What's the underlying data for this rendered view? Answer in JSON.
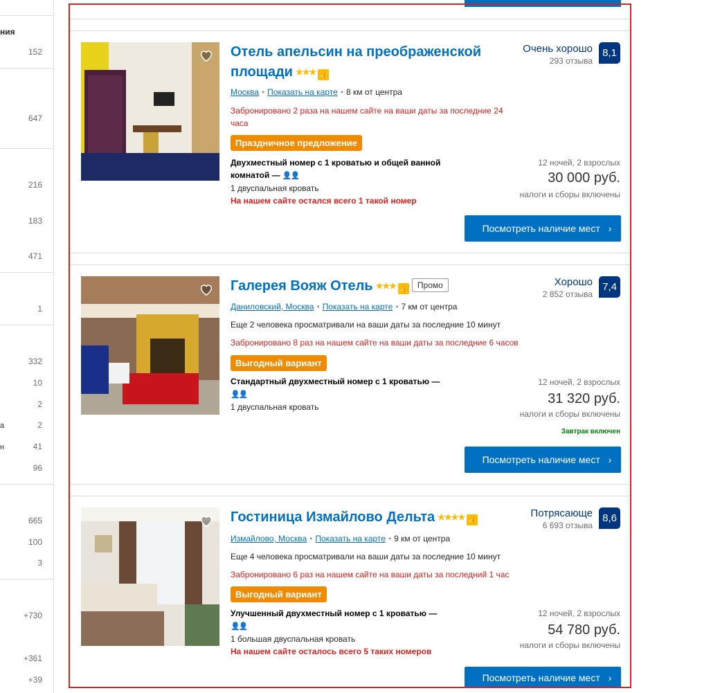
{
  "sidebar": {
    "heading_fragment": "ния",
    "counts": [
      "152",
      "647",
      "216",
      "183",
      "471",
      "1",
      "332",
      "10",
      "2",
      "2",
      "41",
      "96",
      "665",
      "100",
      "3",
      "+730",
      "+361",
      "+39"
    ],
    "edge_fragments": [
      "а",
      "н"
    ]
  },
  "colors": {
    "accent": "#0071c2",
    "score": "#003580",
    "deal": "#f08a00",
    "urgent": "#e0201c",
    "breakfast": "#008009"
  },
  "hotels": [
    {
      "name_line1": "Отель апельсин на преображенской",
      "name_line2": "площади",
      "stars": "★★★",
      "district": "Москва",
      "map_link": "Показать на карте",
      "distance": "8 км от центра",
      "booked_line1": "Забронировано 2 раза на нашем сайте на ваши даты за последние 24",
      "booked_line2": "часа",
      "deal": "Праздничное предложение",
      "room_line1": "Двухместный номер с 1 кроватью и общей ванной",
      "room_line2": "комнатой",
      "bed": "1 двуспальная кровать",
      "scarcity": "На нашем сайте остался всего 1 такой номер",
      "score_word": "Очень хорошо",
      "reviews": "293 отзыва",
      "score": "8,1",
      "nights": "12 ночей, 2 взрослых",
      "price": "30 000 руб.",
      "taxes": "налоги и сборы включены",
      "cta": "Посмотреть наличие мест"
    },
    {
      "name": "Галерея Вояж Отель",
      "stars": "★★★",
      "promo": "Промо",
      "district": "Даниловский, Москва",
      "map_link": "Показать на карте",
      "distance": "7 км от центра",
      "viewing": "Еще 2 человека просматривали на ваши даты за последние 10 минут",
      "booked": "Забронировано 8 раз на нашем сайте на ваши даты за последние 6 часов",
      "deal": "Выгодный вариант",
      "room": "Стандартный двухместный номер с 1 кроватью",
      "bed": "1 двуспальная кровать",
      "score_word": "Хорошо",
      "reviews": "2 852 отзыва",
      "score": "7,4",
      "nights": "12 ночей, 2 взрослых",
      "price": "31 320 руб.",
      "taxes": "налоги и сборы включены",
      "breakfast": "Завтрак включен",
      "cta": "Посмотреть наличие мест"
    },
    {
      "name": "Гостиница Измайлово Дельта",
      "stars": "★★★★",
      "district": "Измайлово, Москва",
      "map_link": "Показать на карте",
      "distance": "9 км от центра",
      "viewing": "Еще 4 человека просматривали на ваши даты за последние 10 минут",
      "booked": "Забронировано 6 раз на нашем сайте на ваши даты за последний 1 час",
      "deal": "Выгодный вариант",
      "room": "Улучшенный двухместный номер с 1 кроватью",
      "bed": "1 большая двуспальная кровать",
      "scarcity": "На нашем сайте осталось всего 5 таких номеров",
      "score_word": "Потрясающе",
      "reviews": "6 693 отзыва",
      "score": "8,6",
      "nights": "12 ночей, 2 взрослых",
      "price": "54 780 руб.",
      "taxes": "налоги и сборы включены",
      "cta": "Посмотреть наличие мест"
    }
  ]
}
